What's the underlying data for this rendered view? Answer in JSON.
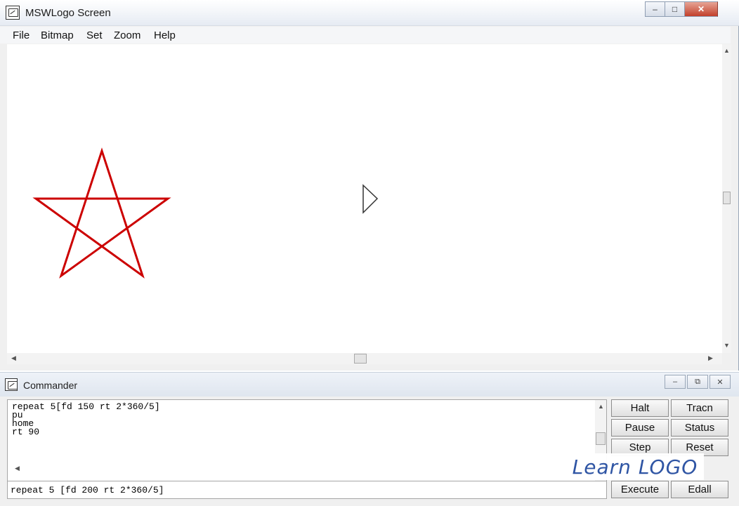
{
  "main_window": {
    "title": "MSWLogo Screen",
    "icon": "mswlogo-app-icon",
    "window_buttons": {
      "minimize": "–",
      "maximize": "□",
      "close": "✕"
    },
    "menu": [
      "File",
      "Bitmap",
      "Set",
      "Zoom",
      "Help"
    ],
    "drawing": {
      "shape": "five-pointed star",
      "pen_color": "#cc0000",
      "turtle": "turtle-triangle"
    }
  },
  "commander": {
    "title": "Commander",
    "icon": "commander-app-icon",
    "window_buttons": {
      "minimize": "–",
      "restore": "⧉",
      "close": "✕"
    },
    "history": "repeat 5[fd 150 rt 2*360/5]\npu\nhome\nrt 90",
    "input_value": "repeat 5 [fd 200 rt 2*360/5]",
    "buttons": {
      "halt": "Halt",
      "trace": "Tracn",
      "pause": "Pause",
      "status": "Status",
      "step": "Step",
      "reset": "Reset",
      "execute": "Execute",
      "edall": "Edall"
    }
  },
  "watermark": "Learn LOGO"
}
